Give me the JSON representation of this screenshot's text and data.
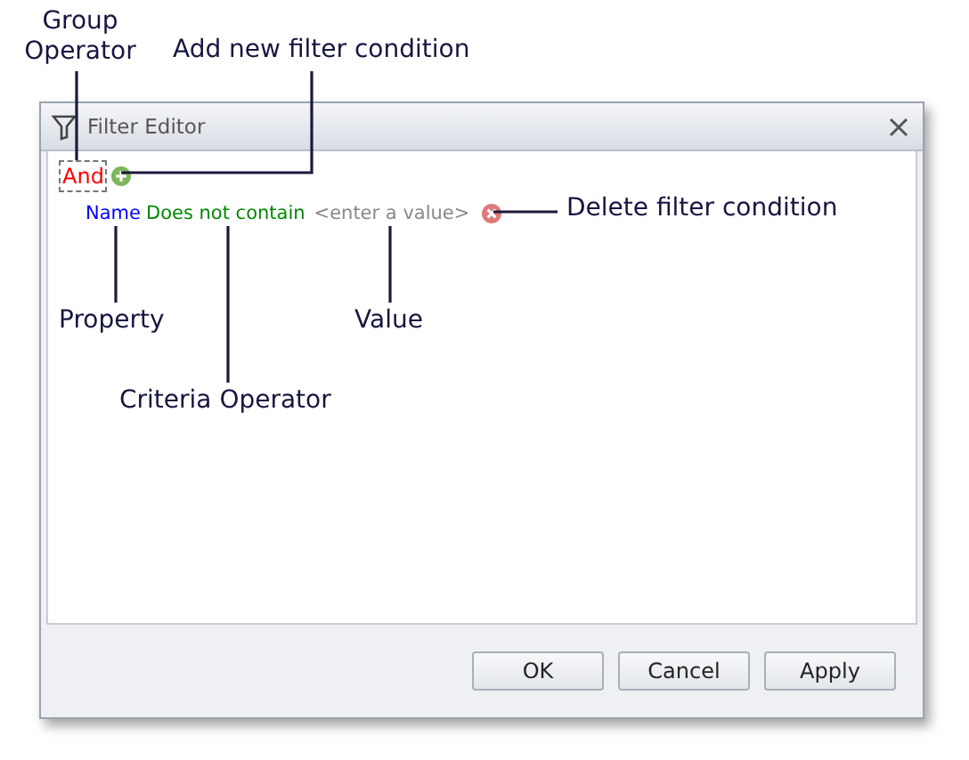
{
  "window": {
    "title": "Filter Editor"
  },
  "filter": {
    "group_operator": "And",
    "condition": {
      "property": "Name",
      "operator": "Does not contain",
      "value": "<enter a value>"
    }
  },
  "buttons": [
    "OK",
    "Cancel",
    "Apply"
  ],
  "callouts": [
    "Group Operator",
    "Add new filter condition",
    "Delete filter condition",
    "Property",
    "Criteria Operator",
    "Value"
  ]
}
